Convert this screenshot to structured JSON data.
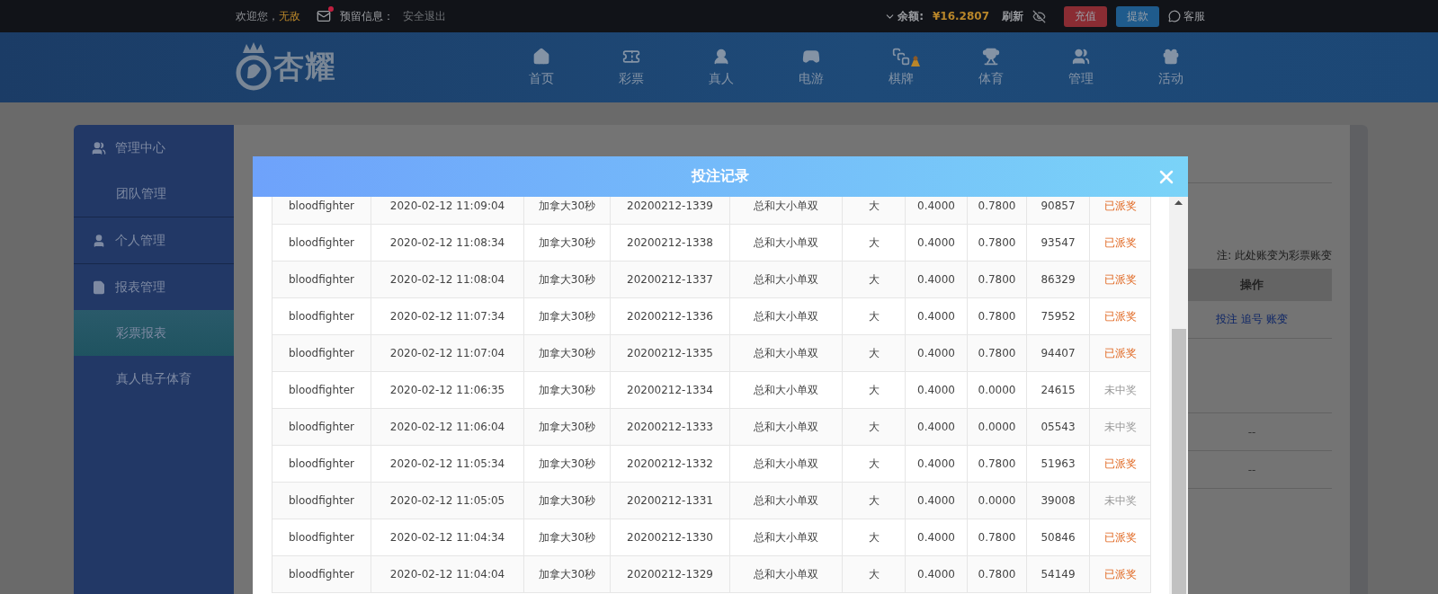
{
  "top_bar": {
    "greeting": "欢迎您，",
    "username": "无敌",
    "mail_unread": true,
    "reserved_label": "预留信息：",
    "logout": "安全退出",
    "balance_label": "余额:",
    "balance": "¥16.2807",
    "refresh": "刷新",
    "deposit": "充值",
    "withdraw": "提款",
    "service": "客服"
  },
  "logo": {
    "text": "杏耀"
  },
  "nav": [
    {
      "label": "首页",
      "badge": false
    },
    {
      "label": "彩票",
      "badge": false
    },
    {
      "label": "真人",
      "badge": false
    },
    {
      "label": "电游",
      "badge": false
    },
    {
      "label": "棋牌",
      "badge": true
    },
    {
      "label": "体育",
      "badge": false
    },
    {
      "label": "管理",
      "badge": false
    },
    {
      "label": "活动",
      "badge": false
    }
  ],
  "sidebar": {
    "groups": [
      {
        "label": "管理中心",
        "children": [
          {
            "label": "团队管理",
            "selected": false
          }
        ]
      },
      {
        "label": "个人管理"
      },
      {
        "label": "报表管理",
        "children": [
          {
            "label": "彩票报表",
            "selected": true
          },
          {
            "label": "真人电子体育",
            "selected": false
          }
        ]
      }
    ]
  },
  "content": {
    "note": "注: 此处账变为彩票账变",
    "table": {
      "columns": [
        "操作"
      ],
      "rows": [
        {
          "kind": "links",
          "links": [
            "投注",
            "追号",
            "账变"
          ]
        },
        {
          "kind": "blank"
        },
        {
          "kind": "text",
          "text": "--"
        },
        {
          "kind": "text",
          "text": "--"
        }
      ]
    }
  },
  "modal": {
    "title": "投注记录",
    "rows": [
      {
        "cells": [
          "bloodfighter",
          "2020-02-12 11:09:04",
          "加拿大30秒",
          "20200212-1339",
          "总和大小单双",
          "大",
          "0.4000",
          "0.7800",
          "90857"
        ],
        "status": "已派奖",
        "won": true
      },
      {
        "cells": [
          "bloodfighter",
          "2020-02-12 11:08:34",
          "加拿大30秒",
          "20200212-1338",
          "总和大小单双",
          "大",
          "0.4000",
          "0.7800",
          "93547"
        ],
        "status": "已派奖",
        "won": true
      },
      {
        "cells": [
          "bloodfighter",
          "2020-02-12 11:08:04",
          "加拿大30秒",
          "20200212-1337",
          "总和大小单双",
          "大",
          "0.4000",
          "0.7800",
          "86329"
        ],
        "status": "已派奖",
        "won": true
      },
      {
        "cells": [
          "bloodfighter",
          "2020-02-12 11:07:34",
          "加拿大30秒",
          "20200212-1336",
          "总和大小单双",
          "大",
          "0.4000",
          "0.7800",
          "75952"
        ],
        "status": "已派奖",
        "won": true
      },
      {
        "cells": [
          "bloodfighter",
          "2020-02-12 11:07:04",
          "加拿大30秒",
          "20200212-1335",
          "总和大小单双",
          "大",
          "0.4000",
          "0.7800",
          "94407"
        ],
        "status": "已派奖",
        "won": true
      },
      {
        "cells": [
          "bloodfighter",
          "2020-02-12 11:06:35",
          "加拿大30秒",
          "20200212-1334",
          "总和大小单双",
          "大",
          "0.4000",
          "0.0000",
          "24615"
        ],
        "status": "未中奖",
        "won": false
      },
      {
        "cells": [
          "bloodfighter",
          "2020-02-12 11:06:04",
          "加拿大30秒",
          "20200212-1333",
          "总和大小单双",
          "大",
          "0.4000",
          "0.0000",
          "05543"
        ],
        "status": "未中奖",
        "won": false
      },
      {
        "cells": [
          "bloodfighter",
          "2020-02-12 11:05:34",
          "加拿大30秒",
          "20200212-1332",
          "总和大小单双",
          "大",
          "0.4000",
          "0.7800",
          "51963"
        ],
        "status": "已派奖",
        "won": true
      },
      {
        "cells": [
          "bloodfighter",
          "2020-02-12 11:05:05",
          "加拿大30秒",
          "20200212-1331",
          "总和大小单双",
          "大",
          "0.4000",
          "0.0000",
          "39008"
        ],
        "status": "未中奖",
        "won": false
      },
      {
        "cells": [
          "bloodfighter",
          "2020-02-12 11:04:34",
          "加拿大30秒",
          "20200212-1330",
          "总和大小单双",
          "大",
          "0.4000",
          "0.7800",
          "50846"
        ],
        "status": "已派奖",
        "won": true
      },
      {
        "cells": [
          "bloodfighter",
          "2020-02-12 11:04:04",
          "加拿大30秒",
          "20200212-1329",
          "总和大小单双",
          "大",
          "0.4000",
          "0.7800",
          "54149"
        ],
        "status": "已派奖",
        "won": true
      }
    ]
  }
}
